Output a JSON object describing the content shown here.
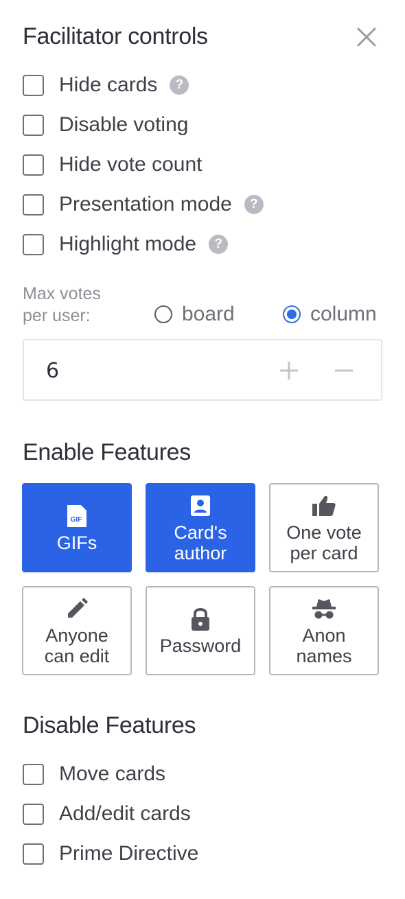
{
  "header": {
    "title": "Facilitator controls",
    "close_icon": "close-icon"
  },
  "controls": [
    {
      "key": "hide_cards",
      "label": "Hide cards",
      "checked": false,
      "help": true
    },
    {
      "key": "disable_voting",
      "label": "Disable voting",
      "checked": false,
      "help": false
    },
    {
      "key": "hide_vote_count",
      "label": "Hide vote count",
      "checked": false,
      "help": false
    },
    {
      "key": "presentation_mode",
      "label": "Presentation mode",
      "checked": false,
      "help": true
    },
    {
      "key": "highlight_mode",
      "label": "Highlight mode",
      "checked": false,
      "help": true
    }
  ],
  "help_glyph": "?",
  "max_votes": {
    "label": "Max votes per user:",
    "options": [
      {
        "label": "board",
        "selected": false
      },
      {
        "label": "column",
        "selected": true
      }
    ],
    "value": "6",
    "increment_icon": "plus-icon",
    "decrement_icon": "minus-icon"
  },
  "enable_features": {
    "title": "Enable Features",
    "items": [
      {
        "label": "GIFs",
        "icon": "gif-file-icon",
        "icon_text": "GIF",
        "active": true
      },
      {
        "label": "Card's\nauthor",
        "icon": "contact-card-icon",
        "active": true
      },
      {
        "label": "One vote\nper card",
        "icon": "thumbs-up-icon",
        "active": false
      },
      {
        "label": "Anyone\ncan edit",
        "icon": "pencil-icon",
        "active": false
      },
      {
        "label": "Password",
        "icon": "lock-icon",
        "active": false
      },
      {
        "label": "Anon\nnames",
        "icon": "incognito-icon",
        "active": false
      }
    ]
  },
  "disable_features": {
    "title": "Disable Features",
    "items": [
      {
        "label": "Move cards",
        "checked": false
      },
      {
        "label": "Add/edit cards",
        "checked": false
      },
      {
        "label": "Prime Directive",
        "checked": false
      }
    ]
  },
  "colors": {
    "accent": "#2a63e6",
    "radio_accent": "#2f6fe4",
    "text": "#3f4049",
    "muted": "#8e8f98",
    "border": "#b5b6bd"
  }
}
